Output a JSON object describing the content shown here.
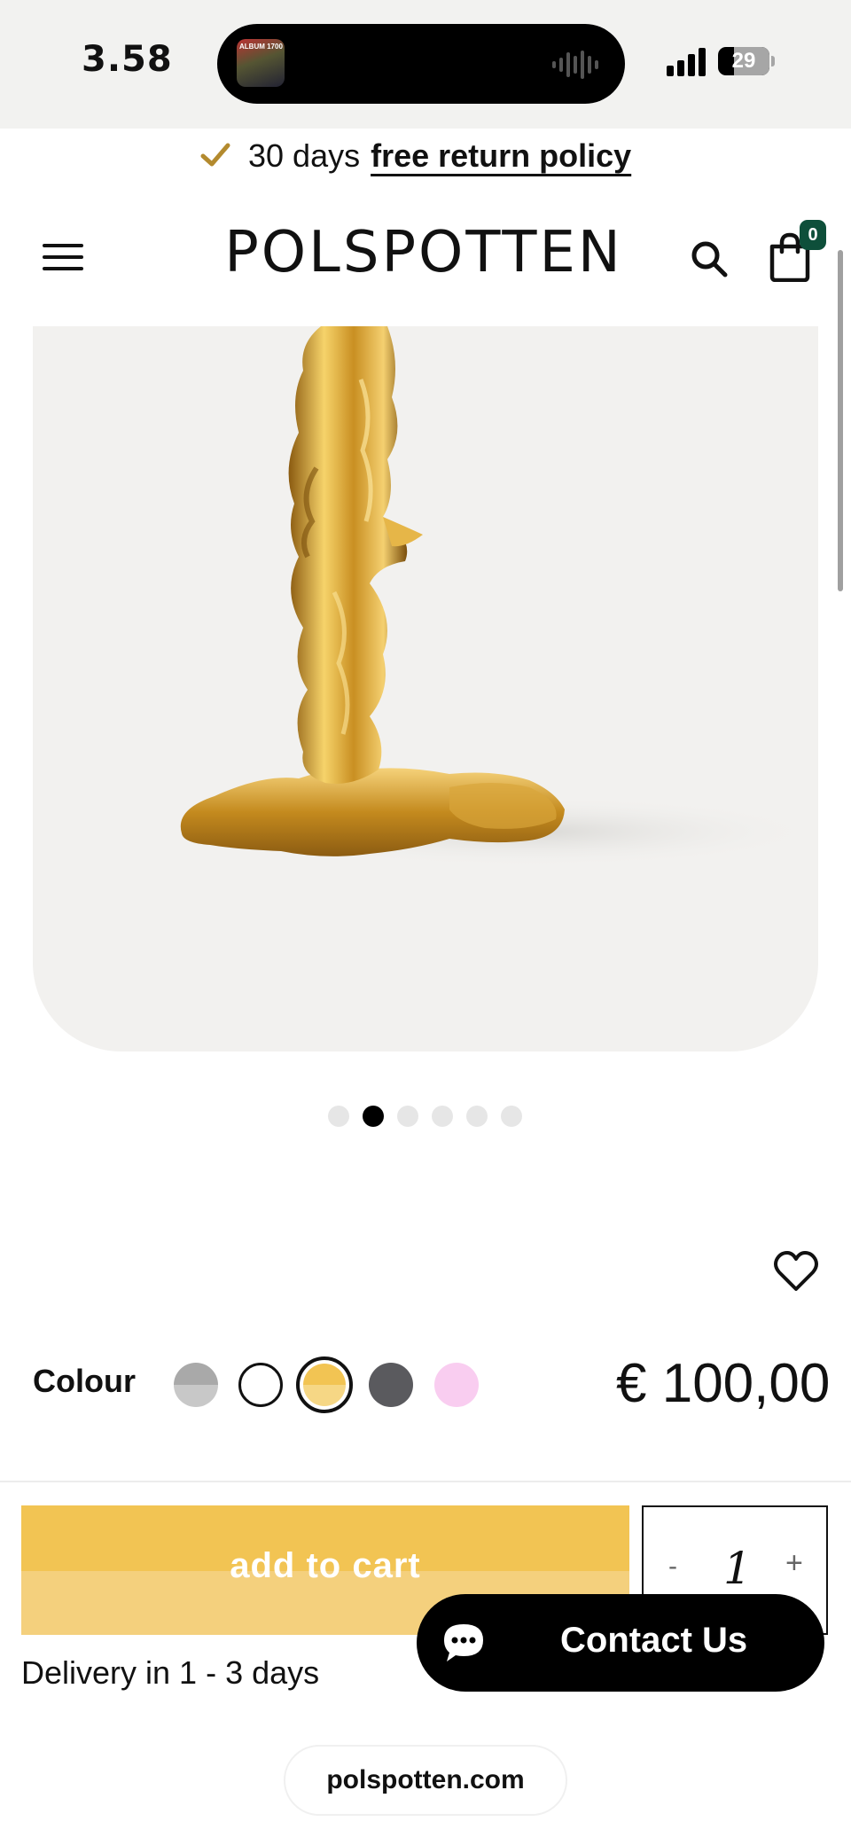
{
  "status_bar": {
    "time": "3.58",
    "album_text": "ALBUM 1700",
    "battery": "29"
  },
  "promo": {
    "prefix": "30 days",
    "link": "free return policy",
    "icon": "checkmark-icon",
    "icon_color": "#b38a2e"
  },
  "header": {
    "logo": "POLSPOTTEN",
    "cart_count": "0",
    "badge_color": "#0e4f3a"
  },
  "gallery": {
    "slides": 6,
    "active_slide": 2
  },
  "product": {
    "colour_label": "Colour",
    "colours": [
      {
        "name": "grey",
        "hex": "#b4b4b4"
      },
      {
        "name": "white",
        "hex": "#ffffff"
      },
      {
        "name": "gold",
        "hex": "#f2c453",
        "selected": true
      },
      {
        "name": "dark grey",
        "hex": "#5a5a5e"
      },
      {
        "name": "pink",
        "hex": "#f9cdf0"
      }
    ],
    "price": "€ 100,00",
    "quantity": "1",
    "qty_minus": "-",
    "qty_plus": "+",
    "add_to_cart": "add to cart",
    "delivery": "Delivery in 1 - 3 days",
    "accent_color": "#f2c453"
  },
  "chat": {
    "label": "Contact Us"
  },
  "browser": {
    "domain": "polspotten.com"
  }
}
